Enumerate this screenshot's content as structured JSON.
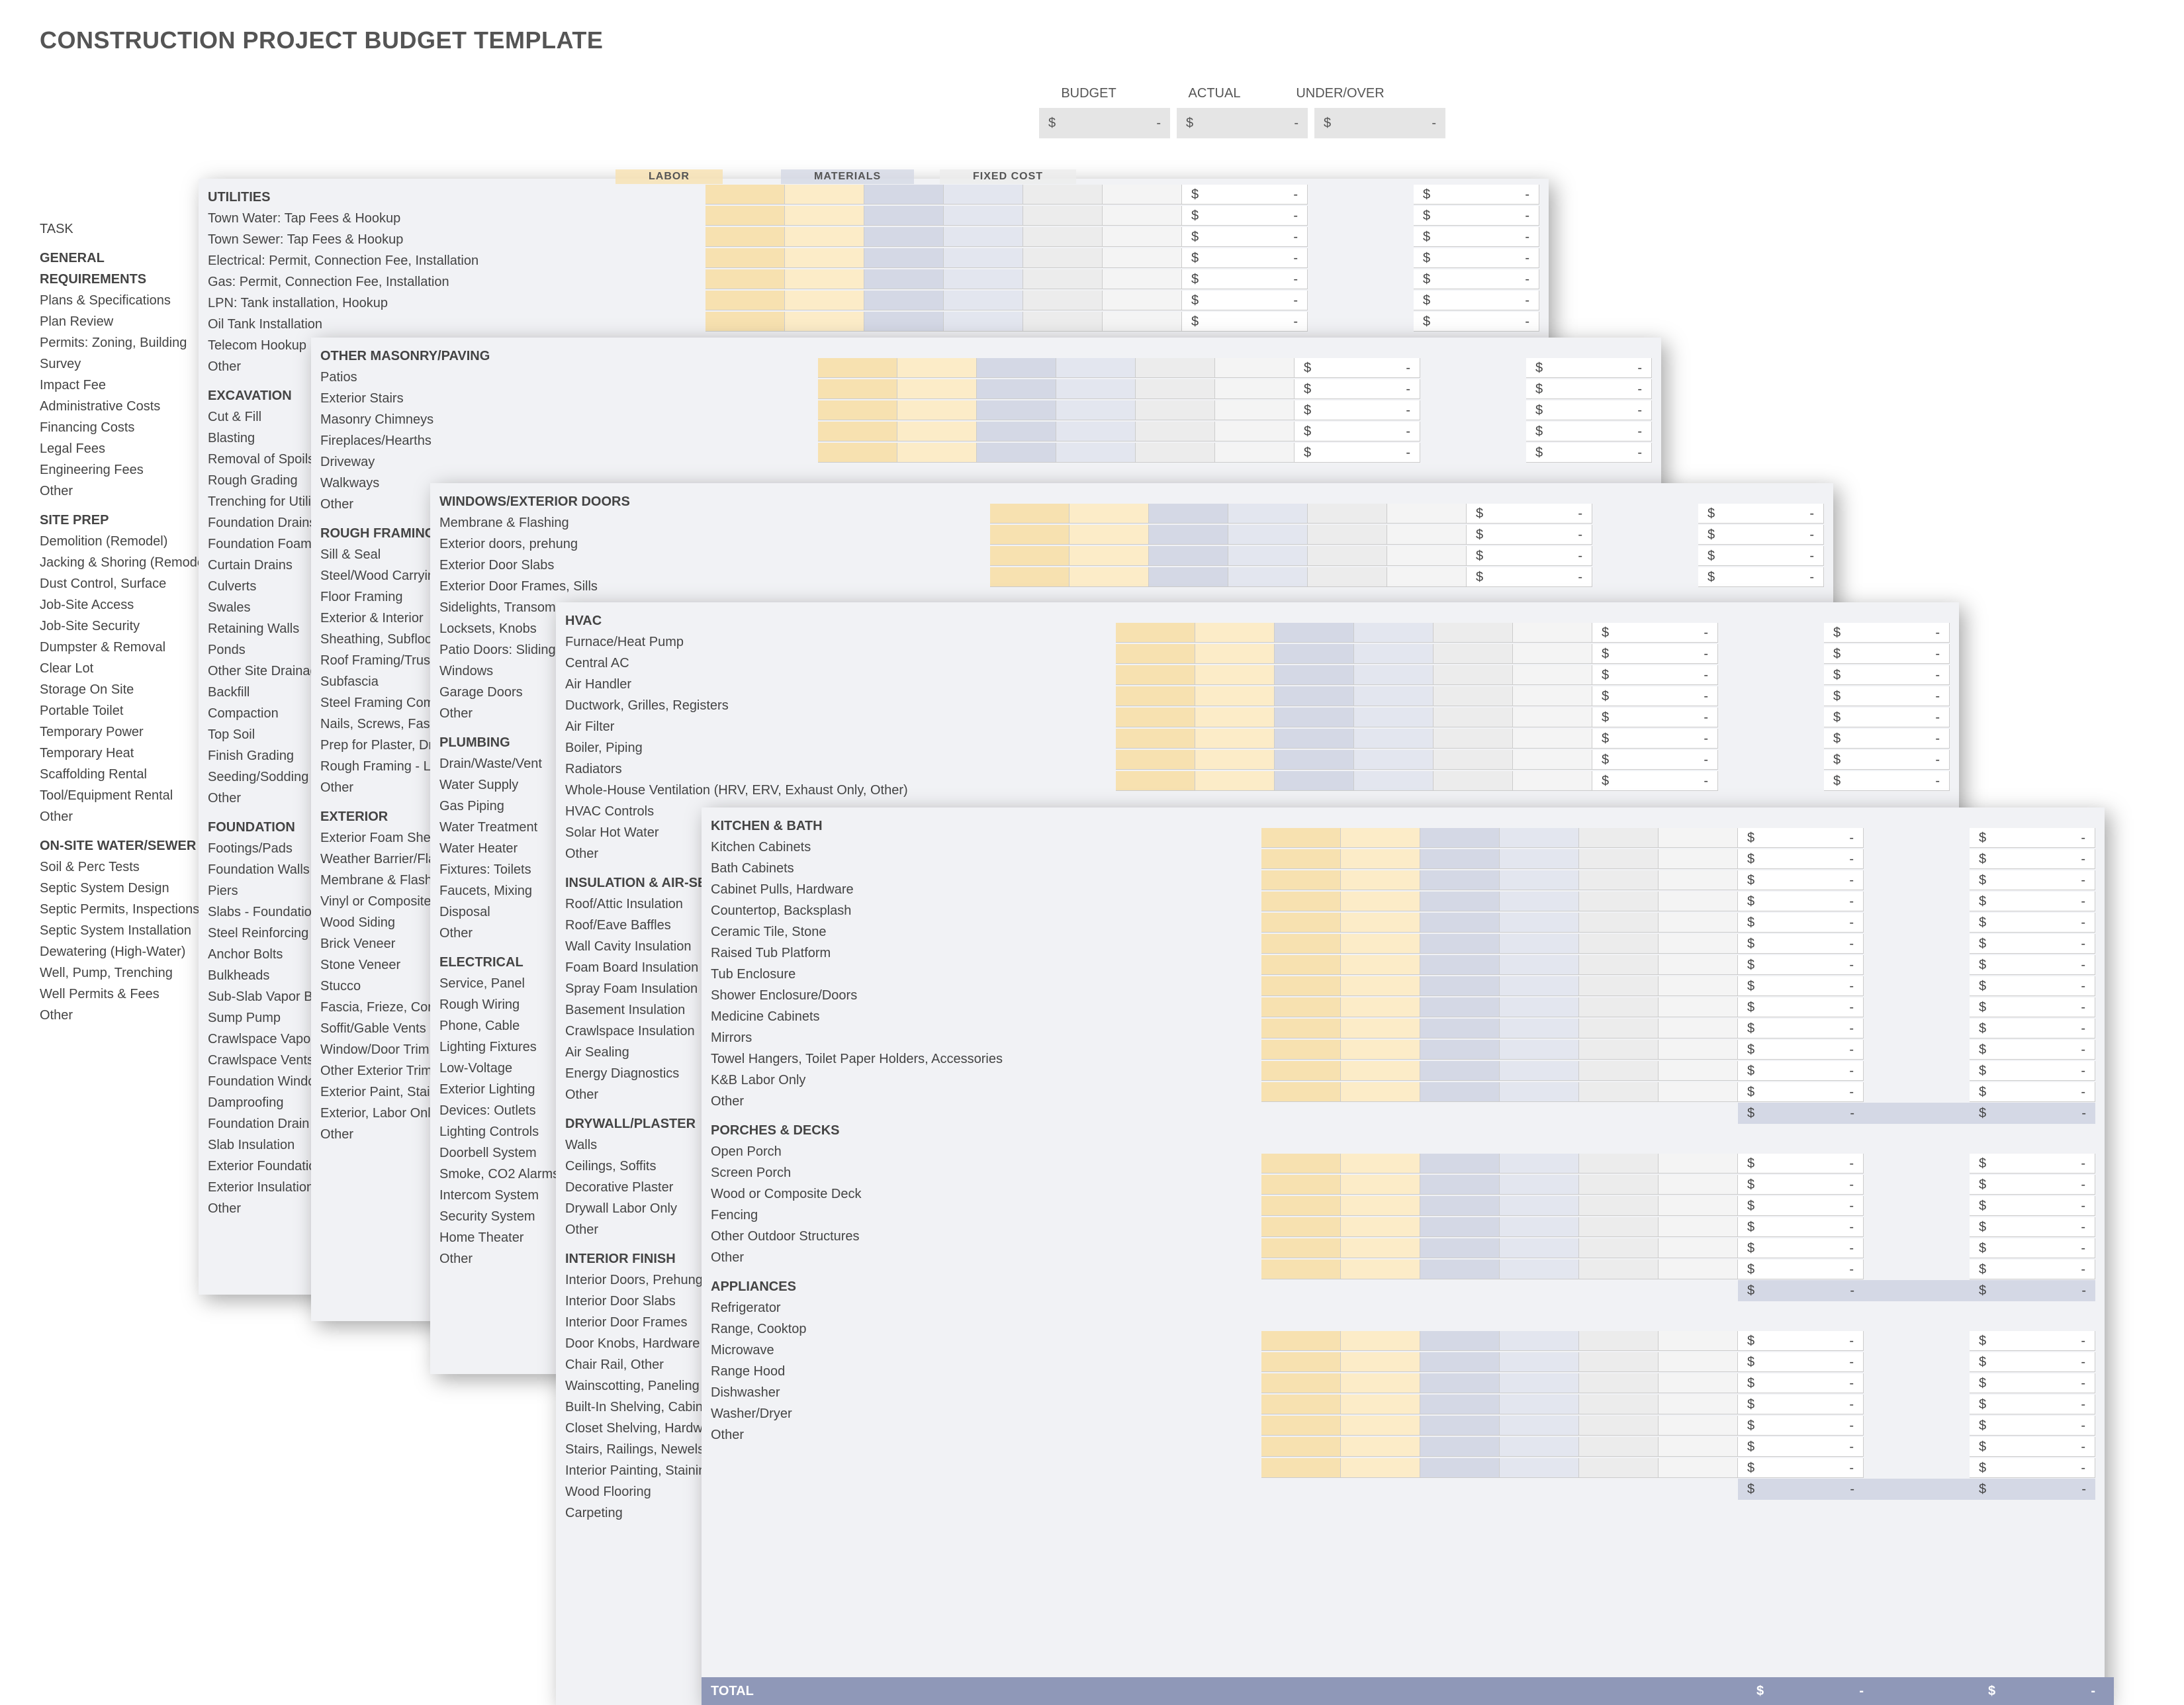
{
  "title": "CONSTRUCTION PROJECT BUDGET TEMPLATE",
  "summary": {
    "headers": [
      "BUDGET",
      "ACTUAL",
      "UNDER/OVER"
    ],
    "cells": [
      {
        "prefix": "$",
        "val": "-"
      },
      {
        "prefix": "$",
        "val": "-"
      },
      {
        "prefix": "$",
        "val": "-"
      }
    ]
  },
  "top_headers": {
    "labor": "LABOR",
    "materials": "MATERIALS",
    "fixed": "FIXED COST"
  },
  "bgcol": {
    "task_label": "TASK",
    "sections": [
      {
        "head": "GENERAL REQUIREMENTS",
        "items": [
          "Plans & Specifications",
          "Plan Review",
          "Permits: Zoning, Building",
          "Survey",
          "Impact Fee",
          "Administrative Costs",
          "Financing Costs",
          "Legal Fees",
          "Engineering Fees",
          "Other"
        ]
      },
      {
        "head": "SITE PREP",
        "items": [
          "Demolition (Remodel)",
          "Jacking & Shoring (Remodel)",
          "Dust Control, Surface",
          "Job-Site Access",
          "Job-Site Security",
          "Dumpster & Removal",
          "Clear Lot",
          "Storage On Site",
          "Portable Toilet",
          "Temporary Power",
          "Temporary Heat",
          "Scaffolding Rental",
          "Tool/Equipment Rental",
          "Other"
        ]
      },
      {
        "head": "ON-SITE WATER/SEWER",
        "items": [
          "Soil & Perc Tests",
          "Septic System Design",
          "Septic Permits, Inspections",
          "Septic System Installation",
          "Dewatering (High-Water)",
          "Well, Pump, Trenching",
          "Well Permits & Fees",
          "Other"
        ]
      }
    ]
  },
  "layer1": {
    "sections_left": [
      {
        "head": "UTILITIES",
        "items": [
          "Town Water: Tap Fees & Hookup",
          "Town Sewer: Tap Fees & Hookup",
          "Electrical: Permit, Connection Fee, Installation",
          "Gas: Permit, Connection Fee, Installation",
          "LPN: Tank installation, Hookup",
          "Oil Tank Installation",
          "Telecom Hookup",
          "Other"
        ]
      },
      {
        "head": "EXCAVATION",
        "items": [
          "Cut & Fill",
          "Blasting",
          "Removal of Spoils",
          "Rough Grading",
          "Trenching for Utilities",
          "Foundation Drains",
          "Foundation Foam",
          "Curtain Drains",
          "Culverts",
          "Swales",
          "Retaining Walls",
          "Ponds",
          "Other Site Drainage",
          "Backfill",
          "Compaction",
          "Top Soil",
          "Finish Grading",
          "Seeding/Sodding",
          "Other"
        ]
      },
      {
        "head": "FOUNDATION",
        "items": [
          "Footings/Pads",
          "Foundation Walls",
          "Piers",
          "Slabs - Foundation",
          "Steel Reinforcing",
          "Anchor Bolts",
          "Bulkheads",
          "Sub-Slab Vapor Barrier",
          "Sump Pump",
          "Crawlspace Vapor Barrier",
          "Crawlspace Vents",
          "Foundation Windows",
          "Damproofing",
          "Foundation Drain",
          "Slab Insulation",
          "Exterior Foundation Insulation",
          "Exterior Insulation Coating/ Protection",
          "Other"
        ]
      }
    ],
    "rows_right": 7
  },
  "layer2": {
    "sections_left": [
      {
        "head": "OTHER MASONRY/PAVING",
        "items": [
          "Patios",
          "Exterior Stairs",
          "Masonry Chimneys",
          "Fireplaces/Hearths",
          "Driveway",
          "Walkways",
          "Other"
        ]
      },
      {
        "head": "ROUGH FRAMING",
        "items": [
          "Sill & Seal",
          "Steel/Wood Carrying",
          "Floor Framing",
          "Exterior & Interior",
          "Sheathing, Subfloor",
          "Roof Framing/Trusses",
          "Subfascia",
          "Steel Framing Components",
          "Nails, Screws, Fasteners",
          "Prep for Plaster, Drywall",
          "Rough Framing - Labor Only",
          "Other"
        ]
      },
      {
        "head": "EXTERIOR",
        "items": [
          "Exterior Foam Sheathing",
          "Weather Barrier/Flashing",
          "Membrane & Flashing",
          "Vinyl or Composite",
          "Wood Siding",
          "Brick Veneer",
          "Stone Veneer",
          "Stucco",
          "Fascia, Frieze, Corner",
          "Soffit/Gable Vents",
          "Window/Door Trim",
          "Other Exterior Trim",
          "Exterior Paint, Stain",
          "Exterior, Labor Only",
          "Other"
        ]
      }
    ],
    "rows_right": 5
  },
  "layer3": {
    "sections_left": [
      {
        "head": "WINDOWS/EXTERIOR DOORS",
        "items": [
          "Membrane & Flashing",
          "Exterior doors, prehung",
          "Exterior Door Slabs",
          "Exterior Door Frames, Sills",
          "Sidelights, Transoms",
          "Locksets, Knobs",
          "Patio Doors: Sliding",
          "Windows",
          "Garage Doors",
          "Other"
        ]
      },
      {
        "head": "PLUMBING",
        "items": [
          "Drain/Waste/Vent",
          "Water Supply",
          "Gas Piping",
          "Water Treatment",
          "Water Heater",
          "Fixtures: Toilets",
          "Faucets, Mixing",
          "Disposal",
          "Other"
        ]
      },
      {
        "head": "ELECTRICAL",
        "items": [
          "Service, Panel",
          "Rough Wiring",
          "Phone, Cable",
          "Lighting Fixtures",
          "Low-Voltage",
          "Exterior Lighting",
          "Devices: Outlets",
          "Lighting Controls",
          "Doorbell System",
          "Smoke, CO2 Alarms",
          "Intercom System",
          "Security System",
          "Home Theater",
          "Other"
        ]
      }
    ],
    "rows_right": 4
  },
  "layer4": {
    "sections_left": [
      {
        "head": "HVAC",
        "items": [
          "Furnace/Heat Pump",
          "Central AC",
          "Air Handler",
          "Ductwork, Grilles, Registers",
          "Air Filter",
          "Boiler, Piping",
          "Radiators",
          "Whole-House Ventilation (HRV, ERV, Exhaust Only, Other)",
          "HVAC Controls",
          "Solar Hot Water",
          "Other"
        ]
      },
      {
        "head": "INSULATION & AIR-SEALING",
        "items": [
          "Roof/Attic Insulation",
          "Roof/Eave Baffles",
          "Wall Cavity Insulation",
          "Foam Board Insulation",
          "Spray Foam Insulation",
          "Basement Insulation",
          "Crawlspace Insulation",
          "Air Sealing",
          "Energy Diagnostics",
          "Other"
        ]
      },
      {
        "head": "DRYWALL/PLASTER",
        "items": [
          "Walls",
          "Ceilings, Soffits",
          "Decorative Plaster",
          "Drywall Labor Only",
          "Other"
        ]
      },
      {
        "head": "INTERIOR FINISH",
        "items": [
          "Interior Doors, Prehung",
          "Interior Door Slabs",
          "Interior Door Frames",
          "Door Knobs, Hardware",
          "Chair Rail, Other",
          "Wainscotting, Paneling",
          "Built-In Shelving, Cabinets",
          "Closet Shelving, Hardware",
          "Stairs, Railings, Newels",
          "Interior Painting, Staining",
          "Wood Flooring",
          "Carpeting"
        ]
      }
    ],
    "rows_right": 8
  },
  "layer5": {
    "sections_left": [
      {
        "head": "KITCHEN & BATH",
        "items": [
          "Kitchen Cabinets",
          "Bath Cabinets",
          "Cabinet Pulls, Hardware",
          "Countertop, Backsplash",
          "Ceramic Tile, Stone",
          "Raised Tub Platform",
          "Tub Enclosure",
          "Shower Enclosure/Doors",
          "Medicine Cabinets",
          "Mirrors",
          "Towel Hangers, Toilet Paper Holders, Accessories",
          "K&B Labor Only",
          "Other"
        ]
      },
      {
        "head": "PORCHES & DECKS",
        "items": [
          "Open Porch",
          "Screen Porch",
          "Wood or Composite Deck",
          "Fencing",
          "Other Outdoor Structures",
          "Other"
        ]
      },
      {
        "head": "APPLIANCES",
        "items": [
          "Refrigerator",
          "Range, Cooktop",
          "Microwave",
          "Range Hood",
          "Dishwasher",
          "Washer/Dryer",
          "Other"
        ]
      }
    ],
    "total_label": "TOTAL",
    "rows_blocks": [
      13,
      6,
      7
    ]
  },
  "money": {
    "prefix": "$",
    "dash": "-"
  }
}
